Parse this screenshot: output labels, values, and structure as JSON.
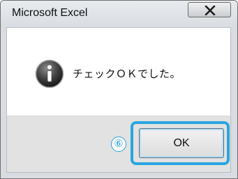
{
  "window": {
    "title": "Microsoft Excel",
    "close_icon": "close-x-icon"
  },
  "message": {
    "icon": "information-icon",
    "text": "チェックＯＫでした。"
  },
  "buttons": {
    "ok_label": "OK"
  },
  "annotation": {
    "step_marker": "⑥",
    "highlight_color": "#2aa6e0"
  }
}
